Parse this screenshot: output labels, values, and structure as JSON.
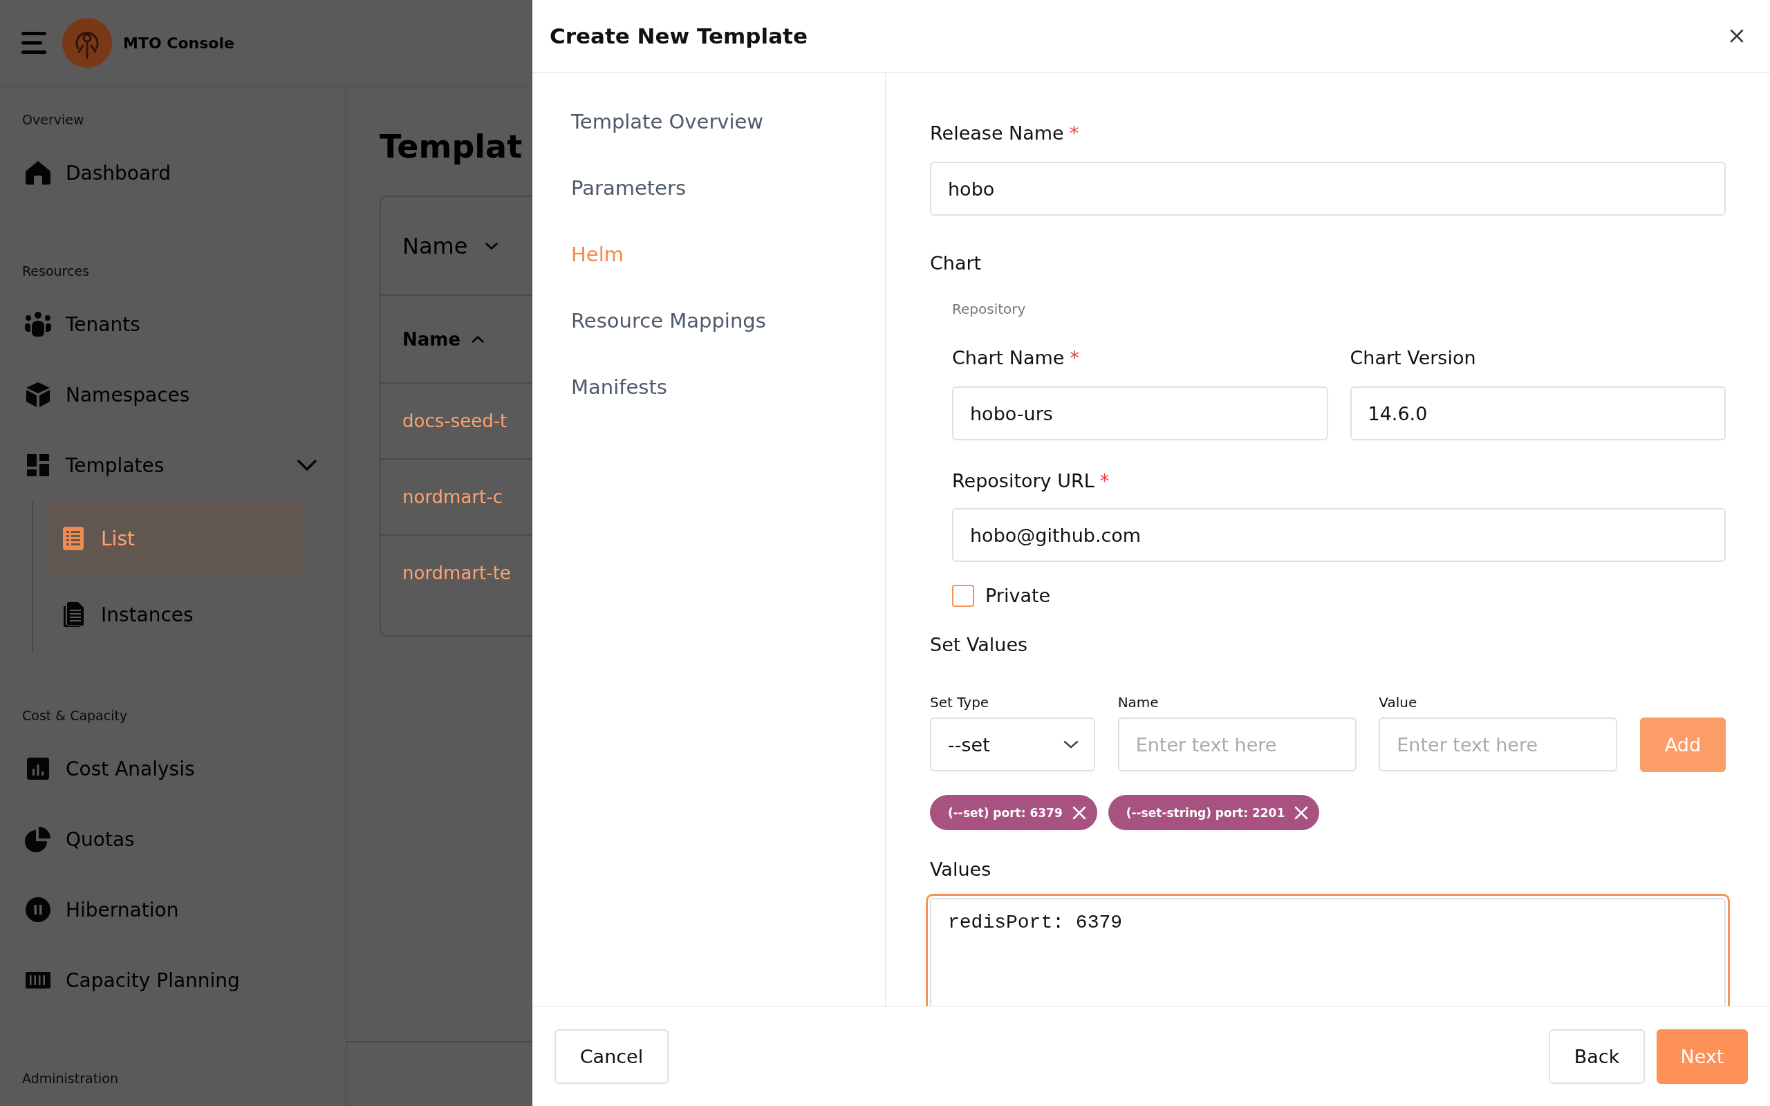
{
  "app": {
    "brand": "MTO Console"
  },
  "sidebar": {
    "sections": [
      {
        "title": "Overview",
        "items": [
          {
            "label": "Dashboard",
            "selected": false
          }
        ]
      },
      {
        "title": "Resources",
        "items": [
          {
            "label": "Tenants",
            "selected": false
          },
          {
            "label": "Namespaces",
            "selected": false
          },
          {
            "label": "Templates",
            "selected": false,
            "expanded": true,
            "children": [
              {
                "label": "List",
                "selected": true
              },
              {
                "label": "Instances",
                "selected": false
              }
            ]
          }
        ]
      },
      {
        "title": "Cost & Capacity",
        "items": [
          {
            "label": "Cost Analysis",
            "selected": false
          },
          {
            "label": "Quotas",
            "selected": false
          },
          {
            "label": "Hibernation",
            "selected": false
          },
          {
            "label": "Capacity Planning",
            "selected": false
          }
        ]
      },
      {
        "title": "Administration"
      }
    ]
  },
  "page": {
    "title": "Templat",
    "filter": {
      "label": "Name"
    },
    "table": {
      "columns": [
        {
          "label": "Name",
          "sort_ascending": true
        }
      ],
      "rows": [
        {
          "name": "docs-seed-t"
        },
        {
          "name": "nordmart-c"
        },
        {
          "name": "nordmart-te"
        }
      ]
    }
  },
  "dialog": {
    "title": "Create New Template",
    "steps": [
      {
        "label": "Template Overview",
        "selected": false
      },
      {
        "label": "Parameters",
        "selected": false
      },
      {
        "label": "Helm",
        "selected": true
      },
      {
        "label": "Resource Mappings",
        "selected": false
      },
      {
        "label": "Manifests",
        "selected": false
      }
    ],
    "helm": {
      "release_name": {
        "label": "Release Name",
        "required_mark": "*",
        "value": "hobo"
      },
      "chart": {
        "title": "Chart",
        "subtitle": "Repository",
        "chart_name": {
          "label": "Chart Name",
          "required_mark": "*",
          "value": "hobo-urs"
        },
        "chart_version": {
          "label": "Chart Version",
          "value": "14.6.0"
        },
        "repository_url": {
          "label": "Repository URL",
          "required_mark": "*",
          "value": "hobo@github.com"
        },
        "private": {
          "label": "Private",
          "checked": false
        }
      },
      "set_values": {
        "title": "Set Values",
        "set_type": {
          "label": "Set Type",
          "value": "--set"
        },
        "name": {
          "label": "Name",
          "placeholder": "Enter text here"
        },
        "value": {
          "label": "Value",
          "placeholder": "Enter text here"
        },
        "add_button": "Add",
        "tags": [
          {
            "label": "(--set) port: 6379"
          },
          {
            "label": "(--set-string) port: 2201"
          }
        ]
      },
      "values": {
        "label": "Values",
        "value": "redisPort: 6379",
        "focused": true
      }
    },
    "footer": {
      "cancel": "Cancel",
      "back": "Back",
      "next": "Next"
    }
  }
}
